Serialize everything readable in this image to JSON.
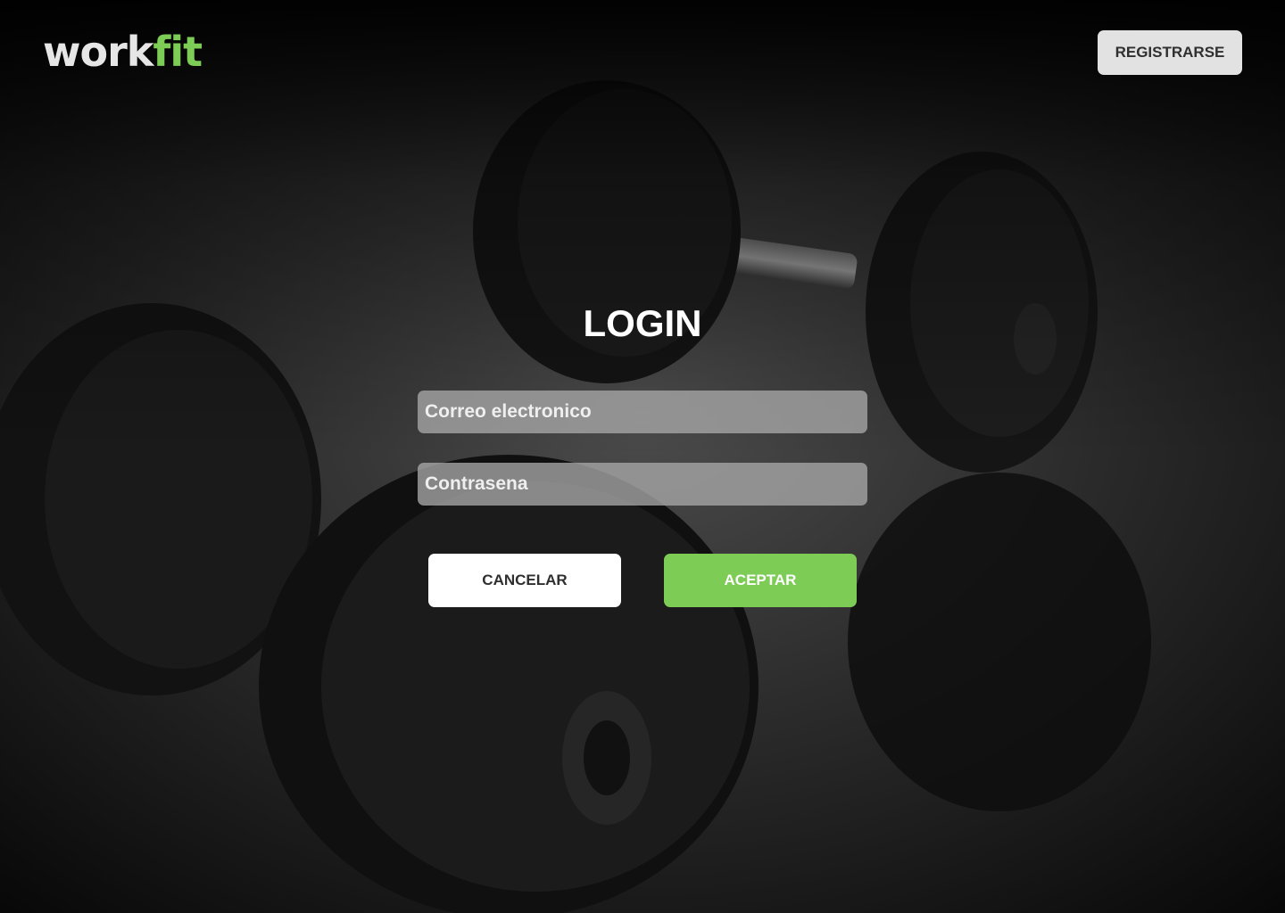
{
  "header": {
    "logo_part_a": "work",
    "logo_part_b": "fit",
    "register_label": "REGISTRARSE"
  },
  "login": {
    "title": "LOGIN",
    "email_placeholder": "Correo electronico",
    "email_value": "",
    "password_placeholder": "Contrasena",
    "password_value": "",
    "cancel_label": "CANCELAR",
    "accept_label": "ACEPTAR"
  },
  "colors": {
    "accent": "#7ccc55",
    "background": "#0c0c0c",
    "field": "#a8a8a8",
    "register_button": "#e2e2e2"
  },
  "background_image": "dumbbells-photo"
}
